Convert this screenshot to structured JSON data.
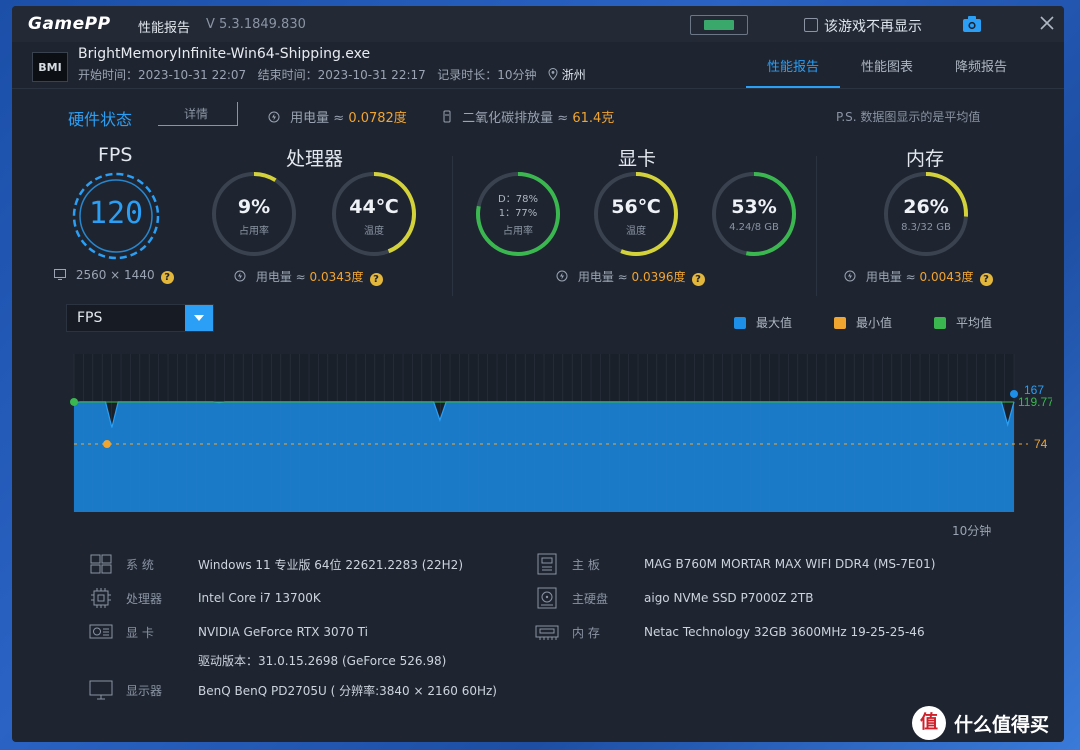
{
  "titlebar": {
    "logo": "GamePP",
    "title": "性能报告",
    "version": "V 5.3.1849.830",
    "no_show_label": "该游戏不再显示"
  },
  "game": {
    "thumb_text": "BMI",
    "name": "BrightMemoryInfinite-Win64-Shipping.exe",
    "start_label": "开始时间：",
    "start_time": "2023-10-31 22:07",
    "end_label": "结束时间：",
    "end_time": "2023-10-31 22:17",
    "duration_label": "记录时长：",
    "duration": "10分钟",
    "location": "浙州"
  },
  "tabs": [
    {
      "label": "性能报告"
    },
    {
      "label": "性能图表"
    },
    {
      "label": "降频报告"
    }
  ],
  "summary": {
    "title": "硬件状态",
    "details_label": "详情",
    "power_label": "用电量 ≈ ",
    "power_value": "0.0782度",
    "carbon_label": "二氧化碳排放量 ≈ ",
    "carbon_value": "61.4克",
    "note": "P.S. 数据图显示的是平均值"
  },
  "fps": {
    "title": "FPS",
    "value": "120",
    "resolution": "2560 × 1440"
  },
  "cpu": {
    "title": "处理器",
    "usage_value": "9%",
    "usage_label": "占用率",
    "usage_fraction": 0.09,
    "temp_value": "44℃",
    "temp_label": "温度",
    "temp_fraction": 0.44,
    "power_label": "用电量 ≈ ",
    "power_value": "0.0343度"
  },
  "gpu": {
    "title": "显卡",
    "usage_line1": "D：78%",
    "usage_line2": "1：77%",
    "usage_label": "占用率",
    "usage_fraction": 0.78,
    "temp_value": "56℃",
    "temp_label": "温度",
    "temp_fraction": 0.56,
    "vram_value": "53%",
    "vram_sub": "4.24/8 GB",
    "vram_fraction": 0.53,
    "power_label": "用电量 ≈ ",
    "power_value": "0.0396度"
  },
  "memory": {
    "title": "内存",
    "usage_value": "26%",
    "usage_sub": "8.3/32 GB",
    "usage_fraction": 0.26,
    "power_label": "用电量 ≈ ",
    "power_value": "0.0043度"
  },
  "chart_controls": {
    "metric": "FPS",
    "legend_max": "最大值",
    "legend_min": "最小值",
    "legend_avg": "平均值",
    "time_label": "10分钟"
  },
  "chart_data": {
    "type": "area",
    "series": [
      {
        "name": "最大值",
        "values": [
          167
        ]
      },
      {
        "name": "最小值",
        "values": [
          74
        ]
      },
      {
        "name": "平均值",
        "values": [
          119.77
        ]
      }
    ],
    "current_values": [
      119,
      120,
      120,
      120,
      120,
      120,
      92,
      120,
      120,
      120,
      120,
      120,
      120,
      120,
      120,
      120,
      120,
      120,
      120,
      120,
      120,
      120,
      120,
      119,
      120,
      120,
      120,
      120,
      120,
      120,
      120,
      120,
      120,
      120,
      120,
      120,
      120,
      120,
      120,
      120,
      120,
      120,
      120,
      120,
      120,
      120,
      120,
      120,
      120,
      120,
      120,
      120,
      120,
      120,
      120,
      120,
      120,
      120,
      100,
      120,
      120,
      120,
      120,
      120,
      120,
      120,
      120,
      120,
      120,
      120,
      120,
      120,
      120,
      120,
      120,
      120,
      120,
      120,
      120,
      120,
      120,
      120,
      120,
      120,
      120,
      120,
      120,
      120,
      120,
      120,
      120,
      120,
      120,
      120,
      120,
      120,
      120,
      120,
      120,
      120,
      120,
      120,
      120,
      120,
      120,
      120,
      120,
      120,
      120,
      120,
      120,
      120,
      120,
      120,
      120,
      120,
      120,
      120,
      120,
      120,
      120,
      120,
      120,
      120,
      120,
      120,
      120,
      120,
      120,
      120,
      120,
      120,
      120,
      120,
      120,
      120,
      120,
      120,
      120,
      120,
      120,
      120,
      120,
      120,
      120,
      120,
      120,
      120,
      95,
      120
    ],
    "max_label": "167",
    "avg_label": "119.77",
    "min_label": "74",
    "ylim": [
      0,
      172
    ]
  },
  "specs": {
    "os_label": "系 统",
    "os_value": "Windows 11 专业版 64位 22621.2283 (22H2)",
    "cpu_label": "处理器",
    "cpu_value": "Intel Core i7 13700K",
    "gpu_label": "显 卡",
    "gpu_value": "NVIDIA GeForce RTX 3070 Ti",
    "driver_value": "驱动版本：31.0.15.2698 (GeForce 526.98)",
    "monitor_label": "显示器",
    "monitor_value": "BenQ BenQ PD2705U ( 分辨率:3840 × 2160 60Hz)",
    "board_label": "主 板",
    "board_value": "MAG B760M MORTAR MAX WIFI DDR4 (MS-7E01)",
    "disk_label": "主硬盘",
    "disk_value": "aigo NVMe SSD P7000Z 2TB",
    "ram_label": "内 存",
    "ram_value": "Netac Technology 32GB 3600MHz 19-25-25-46"
  },
  "watermark": {
    "badge": "值",
    "text": "什么值得买"
  },
  "colors": {
    "accent": "#2a9ff5",
    "max": "#1e8fe8",
    "min": "#f0a531",
    "avg": "#3ab84f",
    "gauge_yellow": "#d4d23a"
  }
}
